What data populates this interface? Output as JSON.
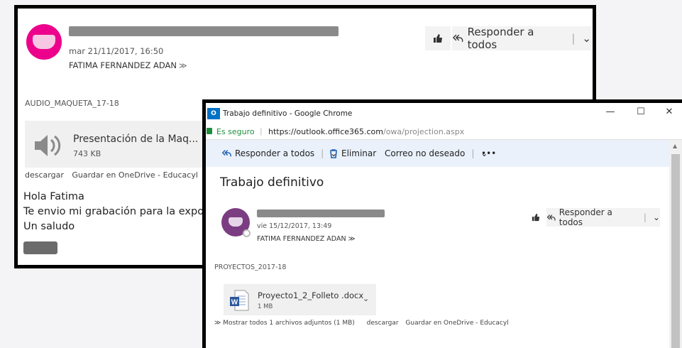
{
  "back_email": {
    "sender": "A_____ ____ C______ ___@gmail.com",
    "date": "mar 21/11/2017, 16:50",
    "to": "FATIMA FERNANDEZ ADAN",
    "reply_all_label": "Responder a todos",
    "attachment_folder": "AUDIO_MAQUETA_17-18",
    "attachment": {
      "name": "Presentación de la Maq...",
      "size": "743 KB"
    },
    "actions": [
      "descargar",
      "Guardar en OneDrive - Educacyl"
    ],
    "body": [
      "Hola Fatima",
      "Te envio mi grabación para la expos",
      "Un saludo"
    ]
  },
  "front_window": {
    "title": "Trabajo definitivo - Google Chrome",
    "app_icon": "O",
    "secure_label": "Es seguro",
    "url_host": "https://outlook.office365.com",
    "url_path": "/owa/projection.aspx",
    "toolbar": {
      "reply_all": "Responder a todos",
      "delete": "Eliminar",
      "junk": "Correo no deseado",
      "more": "•••"
    },
    "subject": "Trabajo definitivo",
    "date": "vie 15/12/2017, 13:49",
    "to": "FATIMA FERNANDEZ ADAN",
    "reply_all_label": "Responder a todos",
    "attachment_folder": "PROYECTOS_2017-18",
    "attachment": {
      "name": "Proyecto1_2_Folleto .docx",
      "size": "1 MB",
      "icon_letter": "W"
    },
    "footer_links": [
      "Mostrar todos 1 archivos adjuntos (1 MB)",
      "descargar",
      "Guardar en OneDrive - Educacyl"
    ]
  },
  "colors": {
    "back_avatar": "#ec008c",
    "front_avatar": "#7b3d82",
    "secure": "#1e8e3e",
    "word": "#2b579a"
  }
}
